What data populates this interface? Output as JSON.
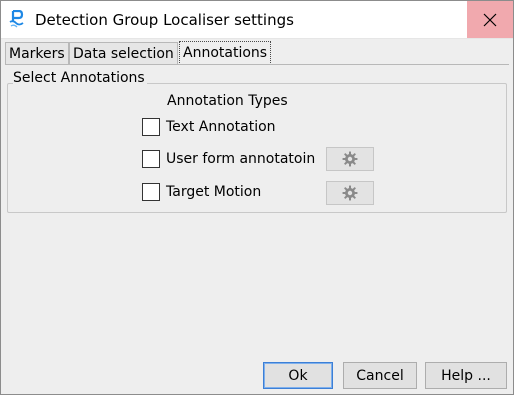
{
  "window": {
    "title": "Detection Group Localiser settings"
  },
  "tabs": [
    {
      "label": "Markers"
    },
    {
      "label": "Data selection"
    },
    {
      "label": "Annotations",
      "active": true
    }
  ],
  "annotations": {
    "group_title": "Select Annotations",
    "types_heading": "Annotation Types",
    "items": [
      {
        "label": "Text Annotation",
        "checked": false,
        "has_settings": false
      },
      {
        "label": "User form annotatoin",
        "checked": false,
        "has_settings": true,
        "settings_icon": "gear-icon"
      },
      {
        "label": "Target Motion",
        "checked": false,
        "has_settings": true,
        "settings_icon": "gear-icon"
      }
    ]
  },
  "buttons": {
    "ok": "Ok",
    "cancel": "Cancel",
    "help": "Help ..."
  },
  "colors": {
    "close_hover": "#f1a9ae",
    "accent": "#3c7fd6",
    "app_icon": "#1e88e5"
  }
}
